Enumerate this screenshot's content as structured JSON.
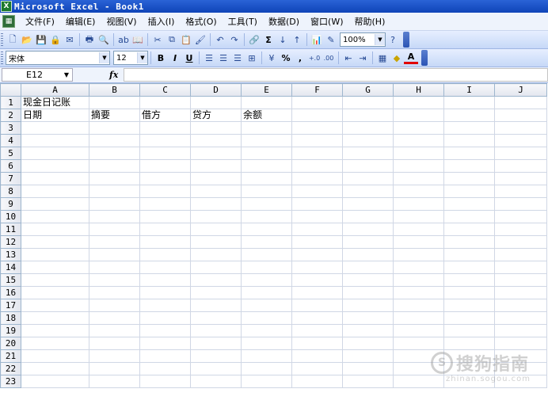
{
  "window": {
    "title": "Microsoft Excel - Book1",
    "app_icon": "X"
  },
  "menu": {
    "doc_icon": "▦",
    "items": [
      "文件(F)",
      "编辑(E)",
      "视图(V)",
      "插入(I)",
      "格式(O)",
      "工具(T)",
      "数据(D)",
      "窗口(W)",
      "帮助(H)"
    ]
  },
  "toolbar_standard": {
    "icons": {
      "new": "🗋",
      "open": "📂",
      "save": "💾",
      "permission": "🔒",
      "mail": "✉",
      "print": "🖶",
      "preview": "🔍",
      "spell": "ab",
      "research": "📖",
      "cut": "✂",
      "copy": "⧉",
      "paste": "📋",
      "format_painter": "🖌",
      "undo": "↶",
      "redo": "↷",
      "hyperlink": "🔗",
      "autosum": "Σ",
      "sort_asc": "↓",
      "sort_desc": "↑",
      "chart": "📊",
      "drawing": "✎",
      "help": "?"
    },
    "zoom": "100%"
  },
  "toolbar_format": {
    "font_name": "宋体",
    "font_size": "12",
    "bold": "B",
    "italic": "I",
    "underline": "U",
    "percent": "%",
    "comma": ",",
    "inc_decimal": "+.0",
    "dec_decimal": ".00",
    "font_color": "A"
  },
  "formula_bar": {
    "name_box": "E12",
    "fx": "fx",
    "formula": ""
  },
  "sheet": {
    "columns": [
      "A",
      "B",
      "C",
      "D",
      "E",
      "F",
      "G",
      "H",
      "I",
      "J"
    ],
    "rows": [
      "1",
      "2",
      "3",
      "4",
      "5",
      "6",
      "7",
      "8",
      "9",
      "10",
      "11",
      "12",
      "13",
      "14",
      "15",
      "16",
      "17",
      "18",
      "19",
      "20",
      "21",
      "22",
      "23"
    ],
    "cells": {
      "A1": "现金日记账",
      "A2": "日期",
      "B2": "摘要",
      "C2": "借方",
      "D2": "贷方",
      "E2": "余额"
    }
  },
  "watermark": {
    "logo": "S",
    "text": "搜狗指南",
    "url": "zhinan.sogou.com"
  }
}
